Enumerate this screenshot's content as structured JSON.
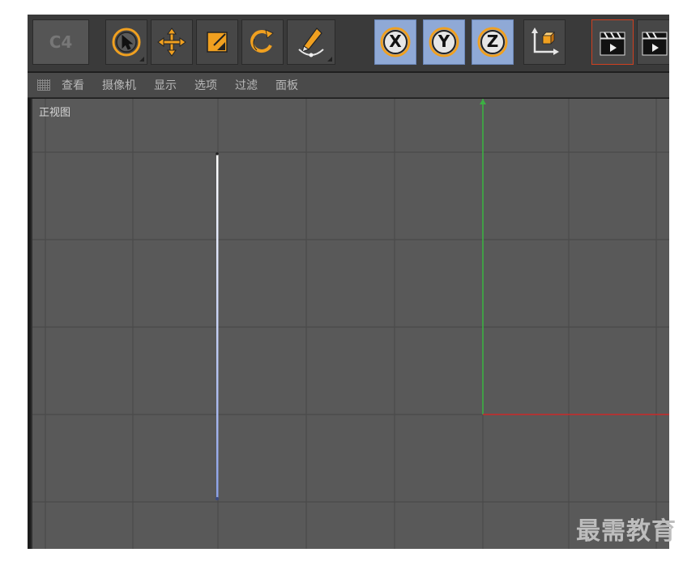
{
  "toolbar": {
    "logo_label": "C4",
    "buttons": [
      {
        "name": "selection-tool",
        "icon": "cursor-arrow-icon"
      },
      {
        "name": "move-tool",
        "icon": "move-arrows-icon"
      },
      {
        "name": "scale-tool",
        "icon": "scale-square-icon"
      },
      {
        "name": "rotate-tool",
        "icon": "rotate-icon"
      },
      {
        "name": "pen-tool",
        "icon": "pen-icon"
      },
      {
        "name": "x-axis-lock",
        "icon": "x-axis-icon",
        "label": "X"
      },
      {
        "name": "y-axis-lock",
        "icon": "y-axis-icon",
        "label": "Y"
      },
      {
        "name": "z-axis-lock",
        "icon": "z-axis-icon",
        "label": "Z"
      },
      {
        "name": "coordinate-system",
        "icon": "coordinate-system-icon"
      },
      {
        "name": "render-view",
        "icon": "clapperboard-icon"
      },
      {
        "name": "render-to-picture-viewer",
        "icon": "clapperboard-icon"
      }
    ],
    "axis_labels": {
      "x": "X",
      "y": "Y",
      "z": "Z"
    }
  },
  "menu": {
    "items": [
      "查看",
      "摄像机",
      "显示",
      "选项",
      "过滤",
      "面板"
    ]
  },
  "viewport": {
    "label": "正视图"
  },
  "watermark": "最需教育",
  "colors": {
    "toolbar_bg": "#3a3a3a",
    "viewport_bg": "#595959",
    "grid_line": "#4a4a4a",
    "y_axis": "#3cb043",
    "x_axis": "#cc2b2b",
    "spline_top": "#ffffff",
    "spline_bottom": "#8aa0e6",
    "icon_orange": "#f0a020",
    "axis_button_blue": "#8fa9d6"
  }
}
